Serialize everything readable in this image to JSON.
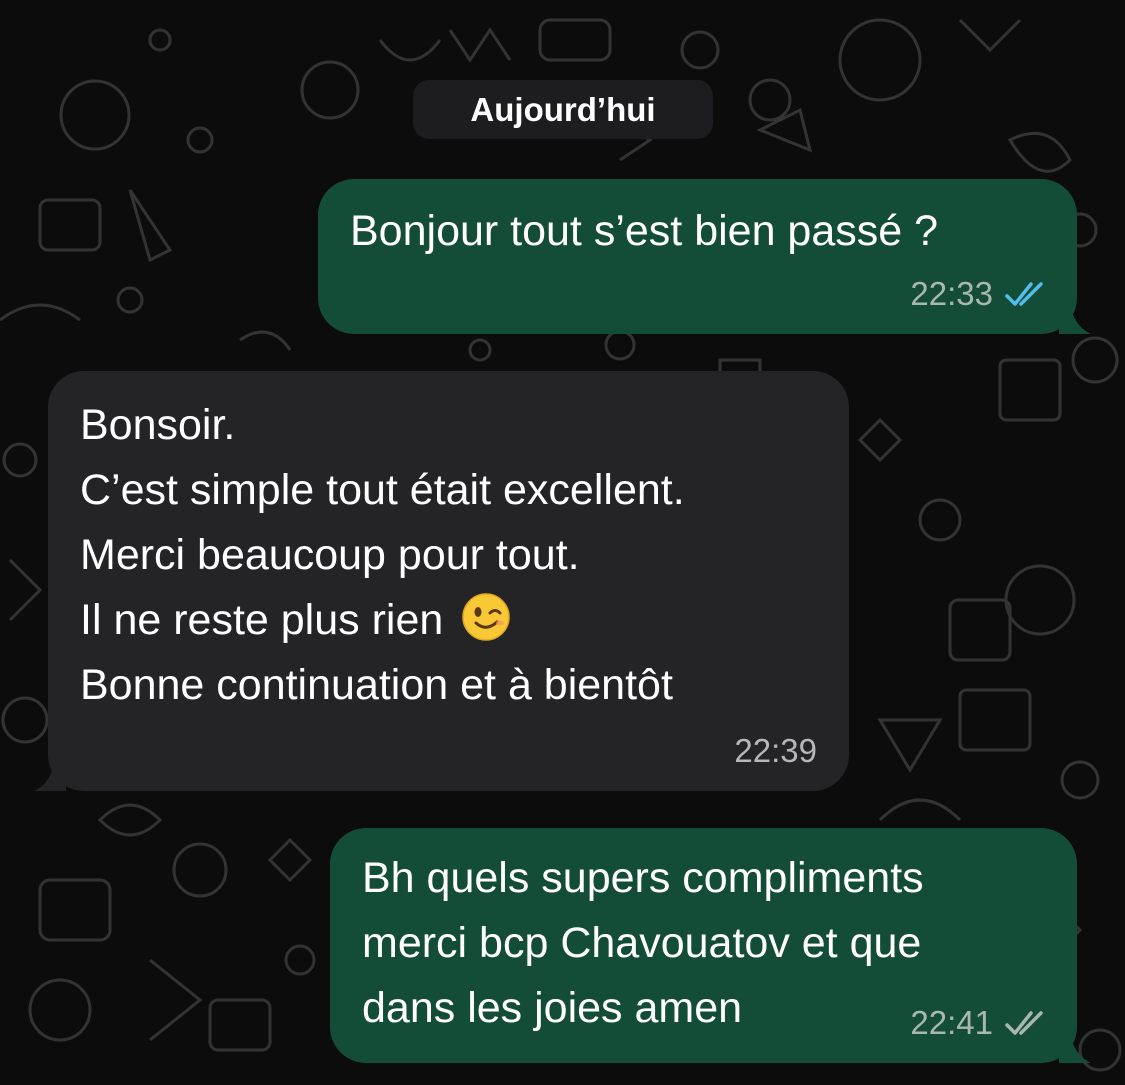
{
  "date_chip": "Aujourd’hui",
  "messages": [
    {
      "direction": "outgoing",
      "text": "Bonjour tout s’est bien passé ?",
      "time": "22:33",
      "status": "read",
      "tick_color": "#53bdeb"
    },
    {
      "direction": "incoming",
      "lines": [
        "Bonsoir.",
        "C’est simple tout était excellent.",
        "Merci beaucoup pour tout.",
        "Il ne reste plus rien",
        "Bonne continuation et à bientôt"
      ],
      "emoji": "winking-face",
      "time": "22:39"
    },
    {
      "direction": "outgoing",
      "lines": [
        "Bh quels supers compliments",
        "merci bcp Chavouatov et que",
        "dans les joies amen"
      ],
      "time": "22:41",
      "status": "delivered",
      "tick_color": "#a8b8ae"
    }
  ],
  "colors": {
    "background": "#0c0c0c",
    "outgoing_bubble": "#144d37",
    "incoming_bubble": "#242426",
    "date_chip": "#1d1d1f"
  }
}
